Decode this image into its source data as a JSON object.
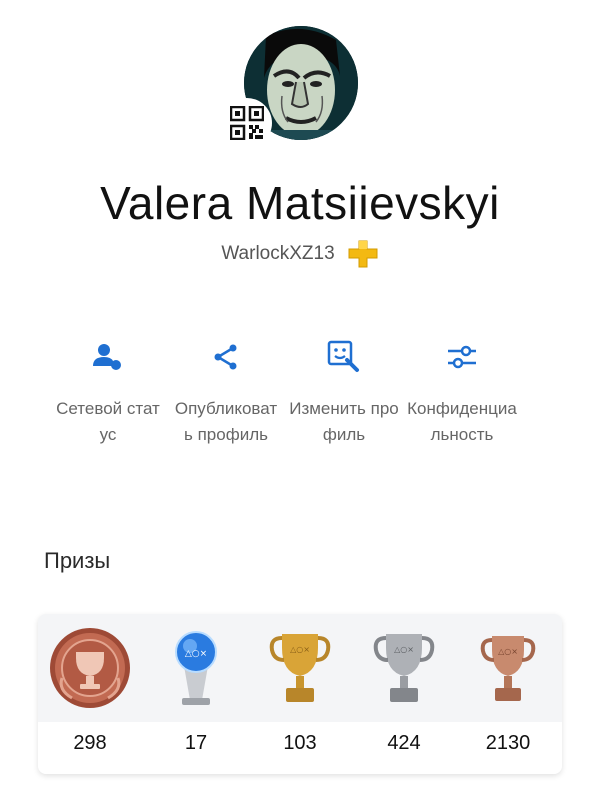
{
  "profile": {
    "real_name": "Valera Matsiievskyi",
    "online_id": "WarlockXZ13",
    "plus_badge": "playstation-plus-icon"
  },
  "actions": [
    {
      "label": "Сетевой статус",
      "icon": "online-status-icon"
    },
    {
      "label": "Опубликовать профиль",
      "icon": "share-icon"
    },
    {
      "label": "Изменить профиль",
      "icon": "edit-profile-icon"
    },
    {
      "label": "Конфиденциальность",
      "icon": "privacy-settings-icon"
    }
  ],
  "trophies": {
    "title": "Призы",
    "items": [
      {
        "type": "level",
        "count": "298"
      },
      {
        "type": "platinum",
        "count": "17"
      },
      {
        "type": "gold",
        "count": "103"
      },
      {
        "type": "silver",
        "count": "424"
      },
      {
        "type": "bronze",
        "count": "2130"
      }
    ]
  },
  "colors": {
    "accent": "#1f6fd1",
    "gold": "#d6a63a",
    "silver": "#a7a9ad",
    "bronze": "#c07c60",
    "level": "#b9604a"
  }
}
